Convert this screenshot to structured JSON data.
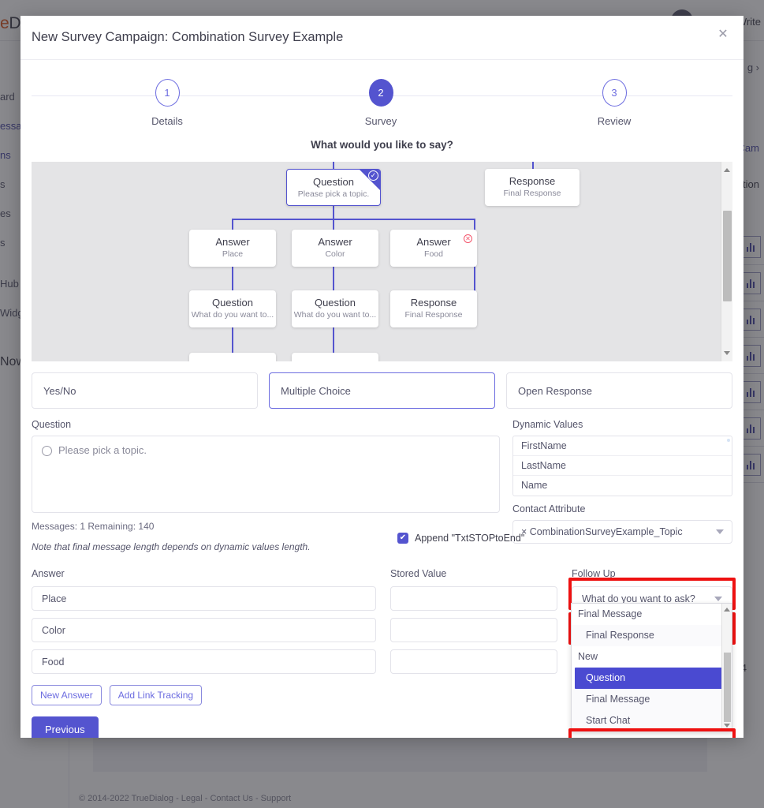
{
  "background": {
    "logo_primary": "e",
    "logo_secondary": "D",
    "write_link": "Write",
    "breadcrumb": "g  ›",
    "new_campaign": "e Cam",
    "action_label": "ction",
    "now_label": "Now",
    "row_number": "4",
    "footer": "© 2014-2022 TrueDialog - Legal - Contact Us - Support",
    "sidebar_items": [
      {
        "label": "ard"
      },
      {
        "label": "essag"
      },
      {
        "label": "ns"
      },
      {
        "label": "s"
      },
      {
        "label": "es"
      },
      {
        "label": "s"
      },
      {
        "label": "Hub"
      },
      {
        "label": "Widg"
      }
    ]
  },
  "modal": {
    "title": "New Survey Campaign: Combination Survey Example",
    "close_label": "✕",
    "stepper": [
      {
        "number": "1",
        "label": "Details",
        "active": false
      },
      {
        "number": "2",
        "label": "Survey",
        "active": true
      },
      {
        "number": "3",
        "label": "Review",
        "active": false
      }
    ],
    "say_prompt": "What would you like to say?"
  },
  "tree": {
    "nodes": [
      {
        "id": "q-root",
        "type": "Question",
        "subtitle": "Please pick a topic.",
        "selected": true,
        "badge": "check"
      },
      {
        "id": "r-top",
        "type": "Response",
        "subtitle": "Final Response",
        "selected": false,
        "badge": "none"
      },
      {
        "id": "a-place",
        "type": "Answer",
        "subtitle": "Place",
        "selected": false,
        "badge": "none"
      },
      {
        "id": "a-color",
        "type": "Answer",
        "subtitle": "Color",
        "selected": false,
        "badge": "none"
      },
      {
        "id": "a-food",
        "type": "Answer",
        "subtitle": "Food",
        "selected": false,
        "badge": "delete"
      },
      {
        "id": "q-place",
        "type": "Question",
        "subtitle": "What do you want to...",
        "selected": false,
        "badge": "none"
      },
      {
        "id": "q-color",
        "type": "Question",
        "subtitle": "What do you want to...",
        "selected": false,
        "badge": "none"
      },
      {
        "id": "r-food",
        "type": "Response",
        "subtitle": "Final Response",
        "selected": false,
        "badge": "none"
      }
    ]
  },
  "type_tabs": [
    {
      "label": "Yes/No",
      "active": false
    },
    {
      "label": "Multiple Choice",
      "active": true
    },
    {
      "label": "Open Response",
      "active": false
    }
  ],
  "question": {
    "label": "Question",
    "value": "Please pick a topic.",
    "messages_count": "Messages: 1 Remaining: 140",
    "note": "Note that final message length depends on dynamic values length.",
    "append_label": "Append \"TxtSTOPtoEnd\"",
    "append_checked": true,
    "check_glyph": "✔"
  },
  "dynamic_values": {
    "label": "Dynamic Values",
    "items": [
      "FirstName",
      "LastName",
      "Name"
    ]
  },
  "contact_attribute": {
    "label": "Contact Attribute",
    "value": "× CombinationSurveyExample_Topic"
  },
  "answers": {
    "headers": [
      "Answer",
      "Stored Value",
      "Follow Up"
    ],
    "rows": [
      {
        "answer": "Place",
        "stored_value": "",
        "follow_up": "What do you want to ask?",
        "highlighted": true,
        "open": false
      },
      {
        "answer": "Color",
        "stored_value": "",
        "follow_up": "What do you want to ask?",
        "highlighted": true,
        "open": false
      },
      {
        "answer": "Food",
        "stored_value": "",
        "follow_up": "Final Response",
        "highlighted": false,
        "open": true
      }
    ]
  },
  "follow_up_dropdown": {
    "options": [
      {
        "label": "Final Message",
        "kind": "group",
        "selected": false,
        "highlighted": false
      },
      {
        "label": "Final Response",
        "kind": "child",
        "selected": true,
        "highlighted": false
      },
      {
        "label": "New",
        "kind": "group",
        "selected": false,
        "highlighted": false
      },
      {
        "label": "Question",
        "kind": "child-sel",
        "selected": false,
        "highlighted": true
      },
      {
        "label": "Final Message",
        "kind": "child",
        "selected": false,
        "highlighted": false
      },
      {
        "label": "Start Chat",
        "kind": "child",
        "selected": false,
        "highlighted": false
      }
    ]
  },
  "buttons": {
    "new_answer": "New Answer",
    "add_link_tracking": "Add Link Tracking",
    "previous": "Previous"
  },
  "colors": {
    "accent": "#5454cf",
    "highlight_red": "#ee1111",
    "canvas": "#e4e4e6"
  }
}
